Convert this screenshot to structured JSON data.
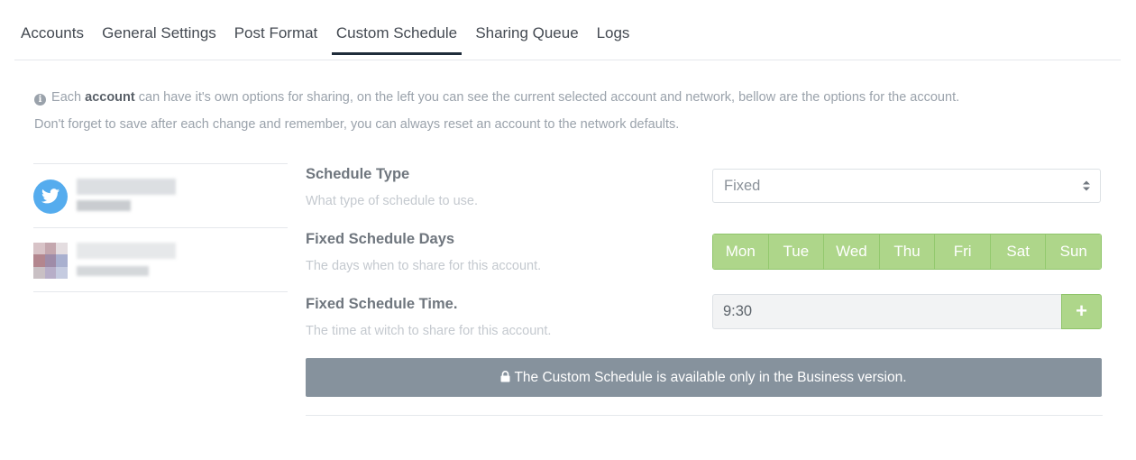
{
  "tabs": [
    {
      "label": "Accounts"
    },
    {
      "label": "General Settings"
    },
    {
      "label": "Post Format"
    },
    {
      "label": "Custom Schedule",
      "active": true
    },
    {
      "label": "Sharing Queue"
    },
    {
      "label": "Logs"
    }
  ],
  "info": {
    "icon": "info-circle-icon",
    "line1_pre": "Each",
    "line1_bold": "account",
    "line1_post": "can have it's own options for sharing, on the left you can see the current selected account and network, bellow are the options for the account.",
    "line2": "Don't forget to save after each change and remember, you can always reset an account to the network defaults."
  },
  "accounts": [
    {
      "network_icon": "twitter-icon",
      "color": "#55acee"
    },
    {
      "network_icon": "avatar-icon"
    }
  ],
  "settings": {
    "schedule_type": {
      "label": "Schedule Type",
      "description": "What type of schedule to use.",
      "value": "Fixed"
    },
    "days": {
      "label": "Fixed Schedule Days",
      "description": "The days when to share for this account.",
      "items": [
        "Mon",
        "Tue",
        "Wed",
        "Thu",
        "Fri",
        "Sat",
        "Sun"
      ]
    },
    "time": {
      "label": "Fixed Schedule Time.",
      "description": "The time at witch to share for this account.",
      "value": "9:30",
      "add_label": "+"
    }
  },
  "banner": {
    "icon": "lock-icon",
    "text": "The Custom Schedule is available only in the Business version."
  },
  "colors": {
    "accent_green": "#aed68a",
    "banner_gray": "#86929d",
    "twitter_blue": "#55acee"
  }
}
